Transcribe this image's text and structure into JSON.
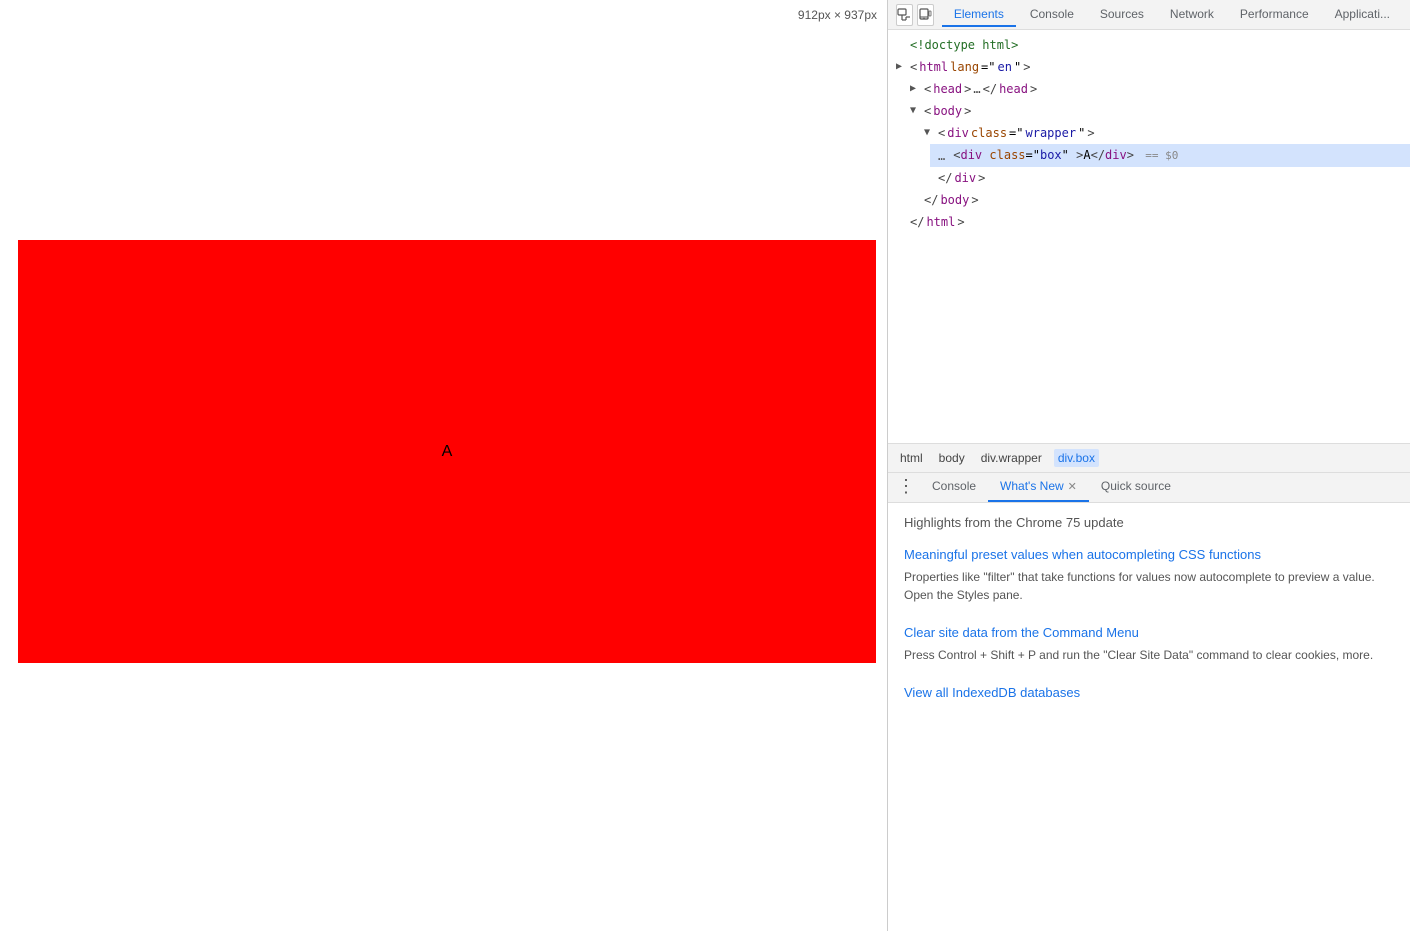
{
  "viewport": {
    "dimension_label": "912px × 937px",
    "red_box_letter": "A"
  },
  "devtools": {
    "toolbar": {
      "icon1": "☰",
      "icon2": "📱",
      "tabs": [
        {
          "label": "Elements",
          "active": true
        },
        {
          "label": "Console",
          "active": false
        },
        {
          "label": "Sources",
          "active": false
        },
        {
          "label": "Network",
          "active": false
        },
        {
          "label": "Performance",
          "active": false
        },
        {
          "label": "Applicati...",
          "active": false
        }
      ]
    },
    "html_tree": [
      {
        "indent": 0,
        "content": "<!doctype html>",
        "type": "comment"
      },
      {
        "indent": 0,
        "content": "<html lang=\"en\">",
        "tag": "html",
        "attrs": [
          {
            "name": "lang",
            "value": "\"en\""
          }
        ]
      },
      {
        "indent": 1,
        "expanded": false,
        "content": "<head>…</head>",
        "tag": "head"
      },
      {
        "indent": 1,
        "expanded": true,
        "content": "<body>",
        "tag": "body"
      },
      {
        "indent": 2,
        "expanded": true,
        "content": "<div class=\"wrapper\">",
        "tag": "div",
        "class": "wrapper"
      },
      {
        "indent": 3,
        "selected": true,
        "content": "<div class=\"box\">A</div>",
        "tag": "div",
        "class": "box",
        "marker": "== $0"
      },
      {
        "indent": 2,
        "content": "</div>",
        "closing": true
      },
      {
        "indent": 1,
        "content": "</body>",
        "closing": true
      },
      {
        "indent": 0,
        "content": "</html>",
        "closing": true
      }
    ],
    "breadcrumbs": [
      {
        "label": "html",
        "active": false
      },
      {
        "label": "body",
        "active": false
      },
      {
        "label": "div.wrapper",
        "active": false
      },
      {
        "label": "div.box",
        "active": true
      }
    ],
    "bottom_tabs": {
      "dots_label": "⋮",
      "tabs": [
        {
          "label": "Console",
          "active": false,
          "closeable": false
        },
        {
          "label": "What's New",
          "active": true,
          "closeable": true
        },
        {
          "label": "Quick source",
          "active": false,
          "closeable": false
        }
      ]
    },
    "whats_new": {
      "highlights_title": "Highlights from the Chrome 75 update",
      "features": [
        {
          "title": "Meaningful preset values when autocompleting CSS functions",
          "desc": "Properties like \"filter\" that take functions for values now autocomplete to preview a value. Open the Styles pane."
        },
        {
          "title": "Clear site data from the Command Menu",
          "desc": "Press Control + Shift + P and run the \"Clear Site Data\" command to clear cookies, more."
        },
        {
          "title": "View all IndexedDB databases"
        }
      ]
    }
  }
}
